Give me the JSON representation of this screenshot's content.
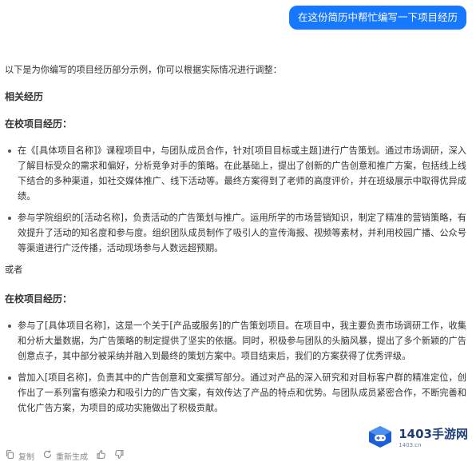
{
  "user_message": "在这份简历中帮忙编写一下项目经历",
  "reply": {
    "intro": "以下是为你编写的项目经历部分示例，你可以根据实际情况进行调整：",
    "heading": "相关经历",
    "section_a": {
      "title": "在校项目经历：",
      "items": [
        "在《[具体项目名称]》课程项目中，与团队成员合作，针对[项目目标或主题]进行广告策划。通过市场调研，深入了解目标受众的需求和偏好，分析竞争对手的策略。在此基础上，提出了创新的广告创意和推广方案，包括线上线下结合的多种渠道，如社交媒体推广、线下活动等。最终方案得到了老师的高度评价，并在班级展示中取得优异成绩。",
        "参与学院组织的[活动名称]，负责活动的广告策划与推广。运用所学的市场营销知识，制定了精准的营销策略，有效提升了活动的知名度和参与度。组织团队成员制作了吸引人的宣传海报、视频等素材，并利用校园广播、公众号等渠道进行广泛传播，活动现场参与人数远超预期。"
      ]
    },
    "or_text": "或者",
    "section_b": {
      "title": "在校项目经历：",
      "items": [
        "参与了[具体项目名称]，这是一个关于[产品或服务]的广告策划项目。在项目中，我主要负责市场调研工作，收集和分析大量数据，为广告策略的制定提供了坚实的依据。同时，积极参与团队的头脑风暴，提出了多个新颖的广告创意点子，其中部分被采纳并融入到最终的策划方案中。项目结束后，我们的方案获得了优秀评级。",
        "曾加入[项目名称]，负责其中的广告创意和文案撰写部分。通过对产品的深入研究和对目标客户群的精准定位，创作出了一系列富有感染力和吸引力的广告文案，有效传达了产品的特点和优势。与团队成员紧密合作，不断完善和优化广告方案，为项目的成功实施做出了积极贡献。"
      ]
    }
  },
  "actions": {
    "copy_label": "复制",
    "regenerate_label": "重新生成"
  },
  "watermark": {
    "name": "1403手游网",
    "url": "1403.cn"
  },
  "colors": {
    "accent": "#1677ff",
    "text": "#333333",
    "muted": "#888888",
    "watermark_blue": "#1f3d7a"
  },
  "icons": [
    "copy-icon",
    "regenerate-icon",
    "thumbs-up-icon",
    "thumbs-down-icon",
    "game-controller-icon"
  ]
}
